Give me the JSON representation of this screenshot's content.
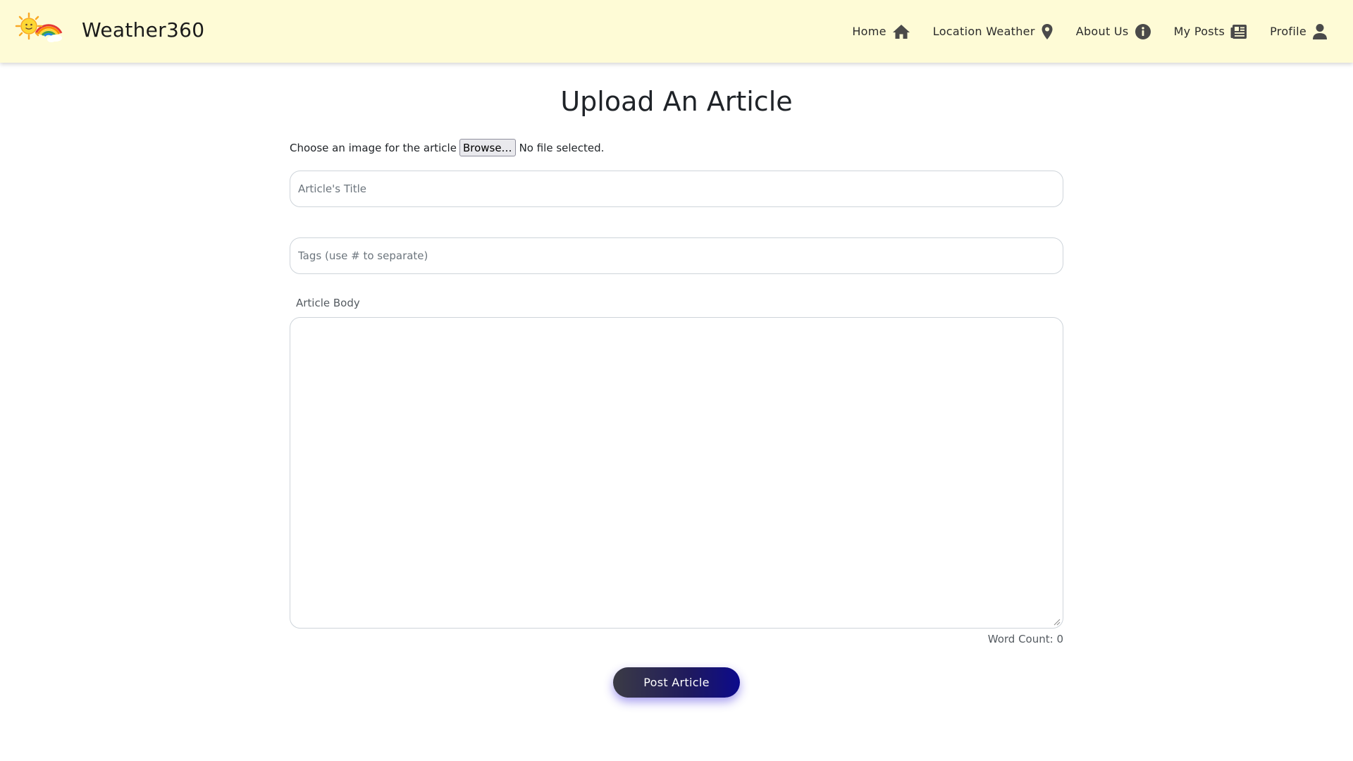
{
  "brand": {
    "name": "Weather360",
    "logo_icon": "sun-rainbow-icon"
  },
  "nav": [
    {
      "label": "Home",
      "icon": "home-icon"
    },
    {
      "label": "Location Weather",
      "icon": "map-pin-icon"
    },
    {
      "label": "About Us",
      "icon": "info-icon"
    },
    {
      "label": "My Posts",
      "icon": "newspaper-icon"
    },
    {
      "label": "Profile",
      "icon": "user-icon"
    }
  ],
  "main": {
    "title": "Upload An Article",
    "file_picker": {
      "label": "Choose an image for the article",
      "button_label": "Browse…",
      "status": "No file selected."
    },
    "title_field": {
      "placeholder": "Article's Title",
      "value": ""
    },
    "tags_field": {
      "placeholder": "Tags (use # to separate)",
      "value": ""
    },
    "body_label": "Article Body",
    "body_value": "",
    "word_count_label": "Word Count: 0",
    "submit_label": "Post Article"
  },
  "colors": {
    "navbar_bg": "#fefbd6",
    "button_gradient_start": "#3b3b45",
    "button_gradient_end": "#0c0a8c"
  }
}
